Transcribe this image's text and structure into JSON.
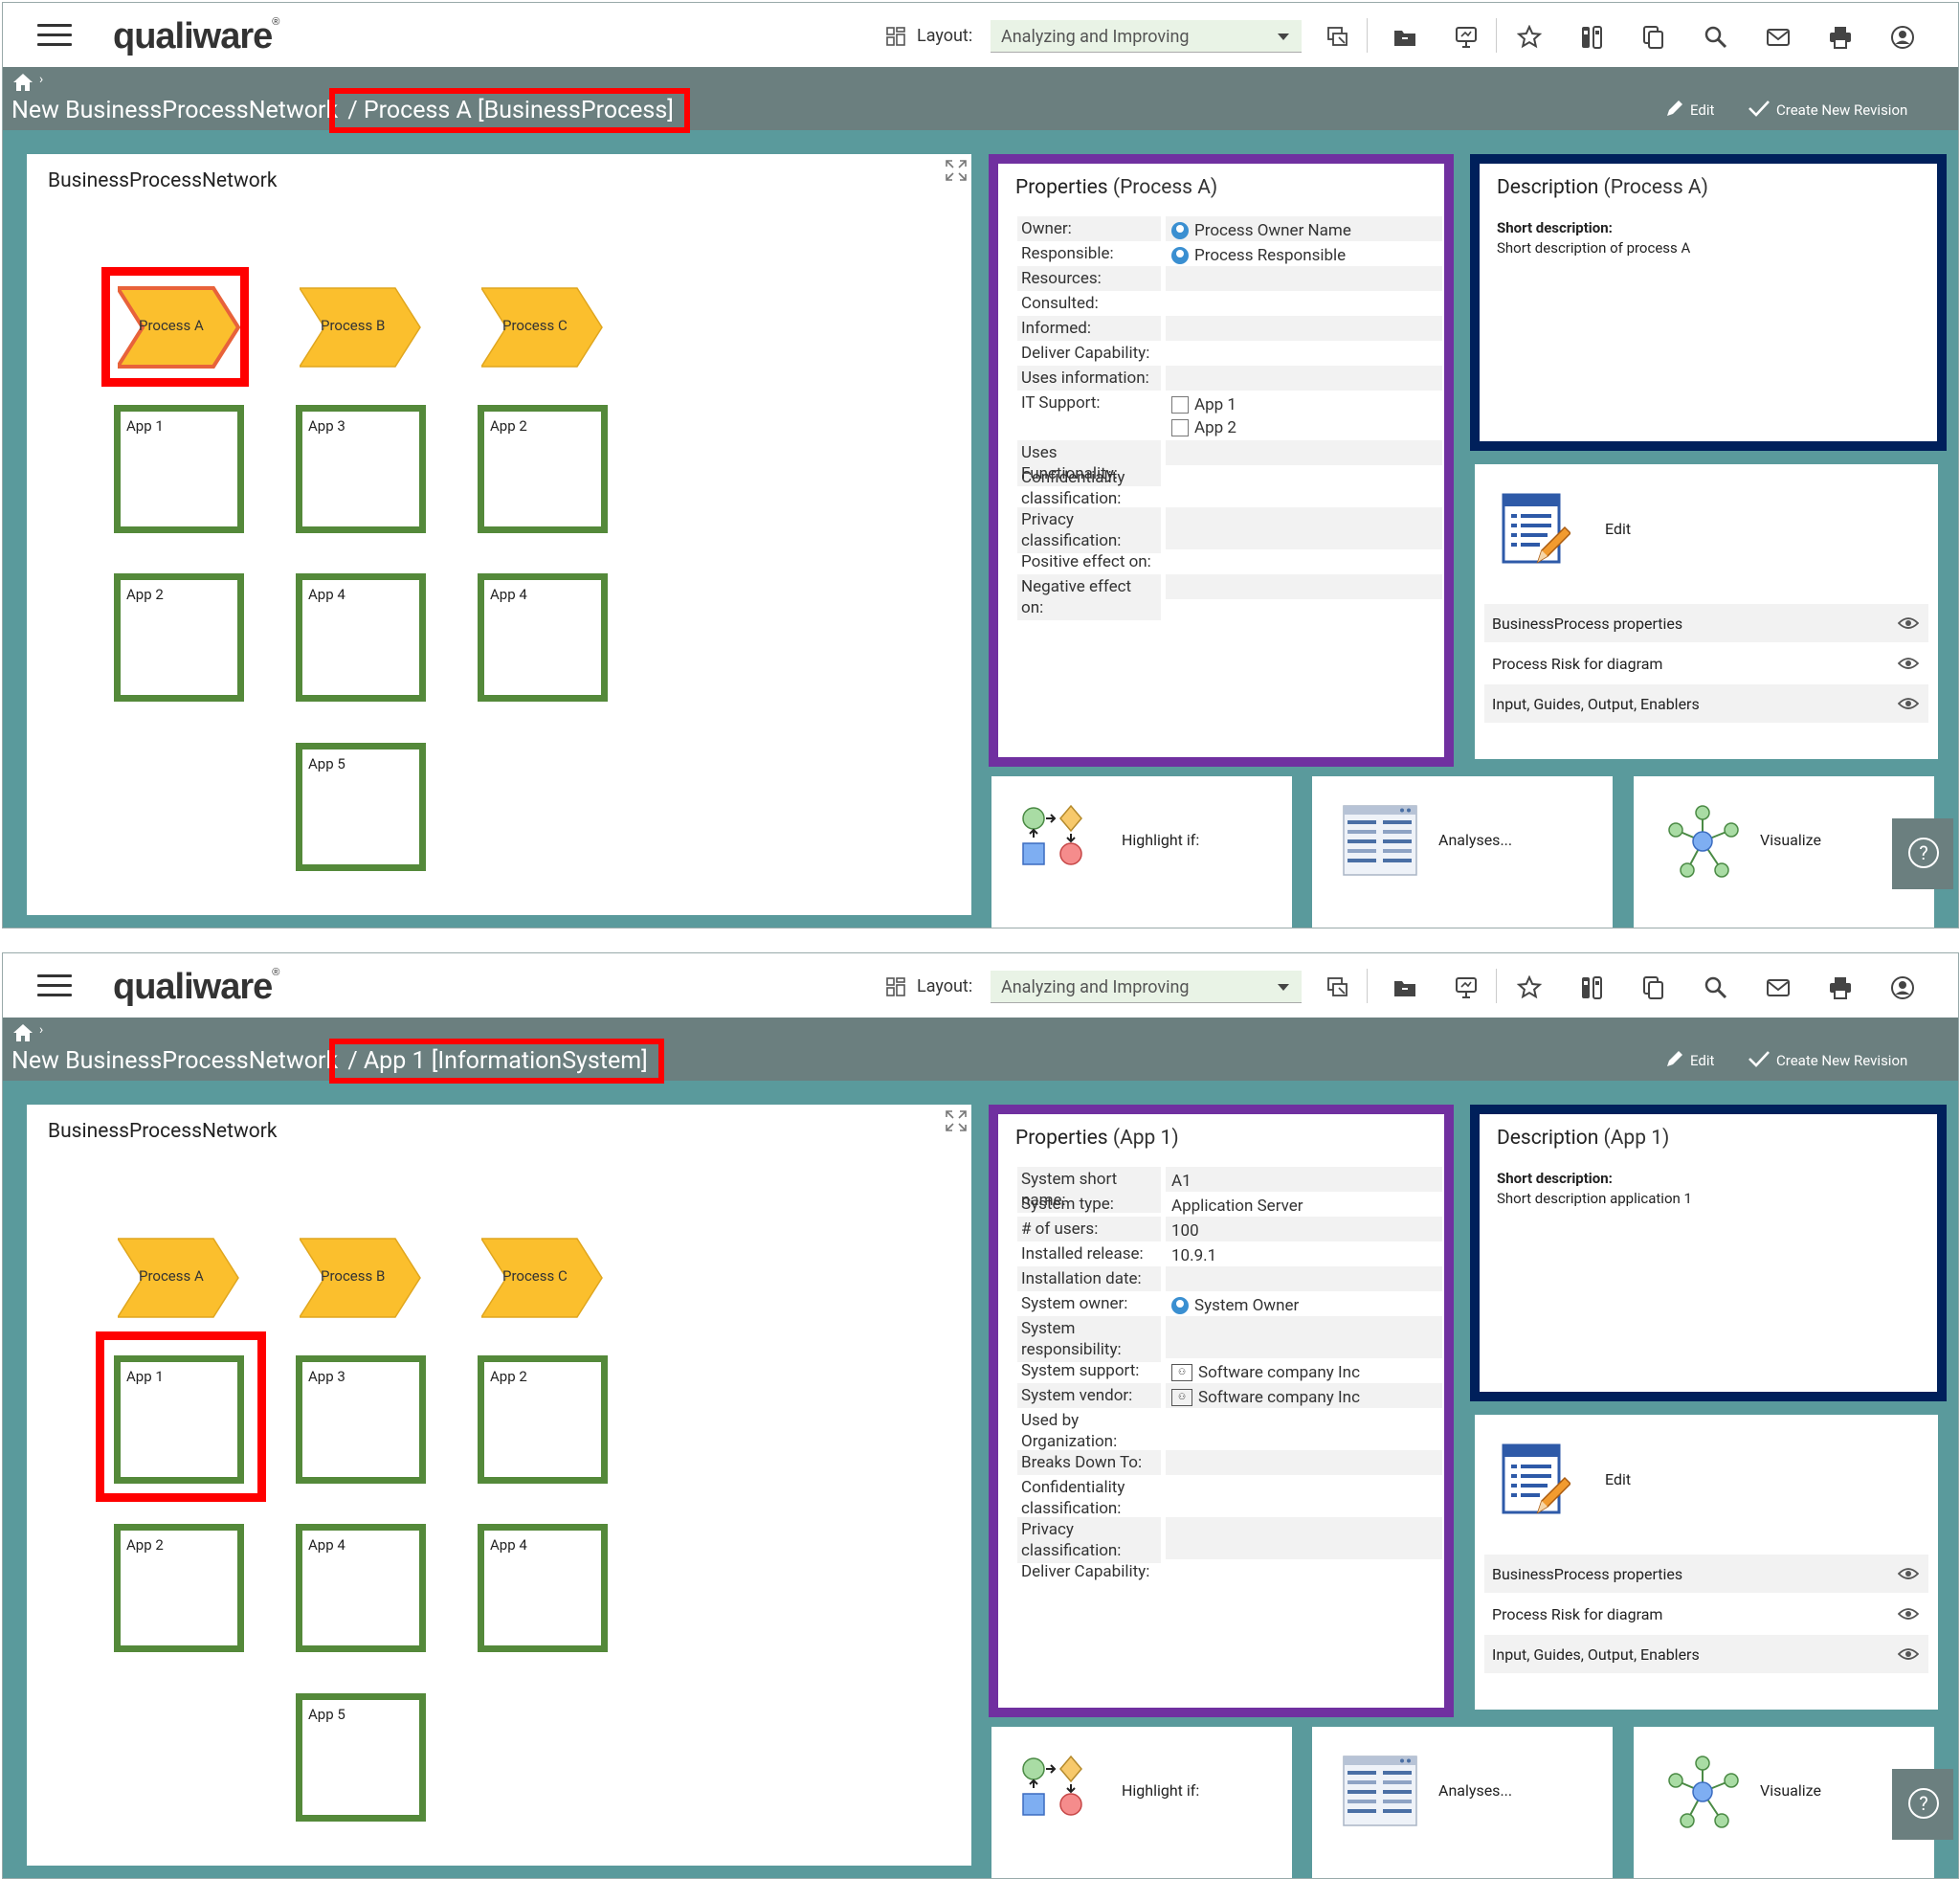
{
  "header": {
    "logo_text": "qualiware",
    "logo_mark": "®",
    "layout_label": "Layout:",
    "layout_value": "Analyzing and Improving",
    "icons": [
      "filter-icon",
      "folder-icon",
      "presentation-icon",
      "star-icon",
      "compare-icon",
      "copy-icon",
      "search-icon",
      "mail-icon",
      "print-icon",
      "user-icon"
    ]
  },
  "actions": {
    "edit_label": "Edit",
    "create_revision_label": "Create New Revision",
    "panel_edit_label": "Edit",
    "panel_items": [
      "BusinessProcess properties",
      "Process Risk for diagram",
      "Input, Guides, Output, Enablers"
    ],
    "tiles": [
      "Highlight if:",
      "Analyses...",
      "Visualize"
    ],
    "help_label": "?"
  },
  "diagram": {
    "title": "BusinessProcessNetwork",
    "processes": [
      "Process A",
      "Process B",
      "Process C"
    ],
    "apps": [
      "App 1",
      "App 3",
      "App 2",
      "App 2",
      "App 4",
      "App 4",
      "App 5"
    ]
  },
  "colors": {
    "teal_background": "#5a9a9c",
    "breadcrumb_bar": "#6b7f7f",
    "highlight_red": "#ff0000",
    "properties_border": "#7030a0",
    "description_border": "#00205b",
    "process_fill": "#fbbf2d",
    "app_border": "#54893a"
  },
  "panels": [
    {
      "breadcrumb": {
        "parent": "New BusinessProcessNetwork",
        "current": " / Process A [BusinessProcess]"
      },
      "selected": "Process A",
      "properties": {
        "title": "Properties",
        "object": "(Process A)",
        "rows": [
          {
            "label": "Owner:",
            "values": [
              "Process Owner Name"
            ],
            "icon": "person-icon"
          },
          {
            "label": "Responsible:",
            "values": [
              "Process Responsible"
            ],
            "icon": "person-icon"
          },
          {
            "label": "Resources:",
            "values": []
          },
          {
            "label": "Consulted:",
            "values": []
          },
          {
            "label": "Informed:",
            "values": []
          },
          {
            "label": "Deliver Capability:",
            "values": []
          },
          {
            "label": "Uses information:",
            "values": []
          },
          {
            "label": "IT Support:",
            "values": [
              "App 1",
              "App 2"
            ],
            "icon": "checkbox-icon"
          },
          {
            "label": "Uses Functionality:",
            "values": []
          },
          {
            "label": "Confidentiality classification:",
            "values": []
          },
          {
            "label": "Privacy classification:",
            "values": []
          },
          {
            "label": "Positive effect on:",
            "values": []
          },
          {
            "label": "Negative effect on:",
            "values": []
          }
        ]
      },
      "description": {
        "title": "Description",
        "object": "(Process A)",
        "short_label": "Short description:",
        "short_value": "Short description of process A"
      }
    },
    {
      "breadcrumb": {
        "parent": "New BusinessProcessNetwork",
        "current": " / App 1 [InformationSystem]"
      },
      "selected": "App 1",
      "properties": {
        "title": "Properties",
        "object": "(App 1)",
        "rows": [
          {
            "label": "System short name:",
            "values": [
              "A1"
            ]
          },
          {
            "label": "System type:",
            "values": [
              "Application Server"
            ]
          },
          {
            "label": "# of users:",
            "values": [
              "100"
            ]
          },
          {
            "label": "Installed release:",
            "values": [
              "10.9.1"
            ]
          },
          {
            "label": "Installation date:",
            "values": []
          },
          {
            "label": "System owner:",
            "values": [
              "System Owner"
            ],
            "icon": "person-icon"
          },
          {
            "label": "System responsibility:",
            "values": []
          },
          {
            "label": "System support:",
            "values": [
              "Software company Inc"
            ],
            "icon": "organization-icon"
          },
          {
            "label": "System vendor:",
            "values": [
              "Software company Inc"
            ],
            "icon": "organization-icon"
          },
          {
            "label": "Used by Organization:",
            "values": []
          },
          {
            "label": "Breaks Down To:",
            "values": []
          },
          {
            "label": "Confidentiality classification:",
            "values": []
          },
          {
            "label": "Privacy classification:",
            "values": []
          },
          {
            "label": "Deliver Capability:",
            "values": []
          }
        ]
      },
      "description": {
        "title": "Description",
        "object": "(App 1)",
        "short_label": "Short description:",
        "short_value": "Short description application 1"
      }
    }
  ]
}
